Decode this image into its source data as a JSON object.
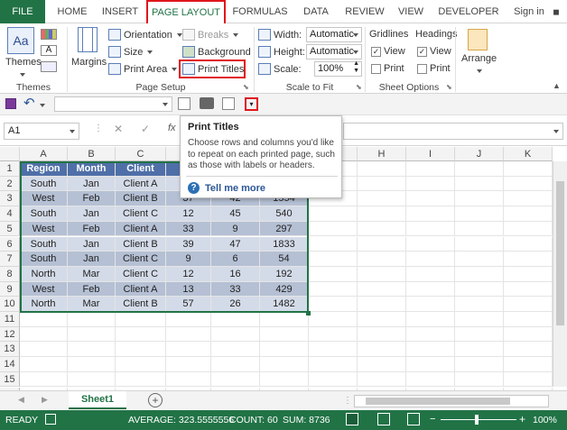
{
  "tabs": [
    "FILE",
    "HOME",
    "INSERT",
    "PAGE LAYOUT",
    "FORMULAS",
    "DATA",
    "REVIEW",
    "VIEW",
    "DEVELOPER"
  ],
  "sign_in": "Sign in",
  "ribbon": {
    "themes": {
      "themes_label": "Themes",
      "group": "Themes"
    },
    "page_setup": {
      "margins": "Margins",
      "orientation": "Orientation",
      "size": "Size",
      "print_area": "Print Area",
      "breaks": "Breaks",
      "background": "Background",
      "print_titles": "Print Titles",
      "group": "Page Setup"
    },
    "scale": {
      "width_label": "Width:",
      "width_value": "Automatic",
      "height_label": "Height:",
      "height_value": "Automatic",
      "scale_label": "Scale:",
      "scale_value": "100%",
      "group": "Scale to Fit"
    },
    "sheet_options": {
      "gridlines": "Gridlines",
      "headings": "Headings",
      "view": "View",
      "print": "Print",
      "group": "Sheet Options"
    },
    "arrange": "Arrange"
  },
  "name_box": "A1",
  "fx": "fx",
  "tooltip": {
    "title": "Print Titles",
    "body": "Choose rows and columns you'd like to repeat on each printed page, such as those with labels or headers.",
    "link": "Tell me more"
  },
  "columns": [
    "A",
    "B",
    "C",
    "D",
    "E",
    "F",
    "G",
    "H",
    "I",
    "J",
    "K"
  ],
  "header_row": [
    "Region",
    "Month",
    "Client",
    "Qu",
    "",
    "",
    ""
  ],
  "rows": [
    [
      "South",
      "Jan",
      "Client A",
      "",
      "",
      "",
      ""
    ],
    [
      "West",
      "Feb",
      "Client B",
      "37",
      "42",
      "1554"
    ],
    [
      "South",
      "Jan",
      "Client C",
      "12",
      "45",
      "540"
    ],
    [
      "West",
      "Feb",
      "Client A",
      "33",
      "9",
      "297"
    ],
    [
      "South",
      "Jan",
      "Client B",
      "39",
      "47",
      "1833"
    ],
    [
      "South",
      "Jan",
      "Client C",
      "9",
      "6",
      "54"
    ],
    [
      "North",
      "Mar",
      "Client C",
      "12",
      "16",
      "192"
    ],
    [
      "West",
      "Feb",
      "Client A",
      "13",
      "33",
      "429"
    ],
    [
      "North",
      "Mar",
      "Client B",
      "57",
      "26",
      "1482"
    ]
  ],
  "row_numbers": [
    "1",
    "2",
    "3",
    "4",
    "5",
    "6",
    "7",
    "8",
    "9",
    "10",
    "11",
    "12",
    "13",
    "14",
    "15",
    "16"
  ],
  "sheet_tab": "Sheet1",
  "status": {
    "ready": "READY",
    "average": "AVERAGE: 323.5555556",
    "count": "COUNT: 60",
    "sum": "SUM: 8736",
    "zoom": "100%"
  },
  "colors": {
    "excel_green": "#217346",
    "accent_red": "#e0161b",
    "header_blue": "#4f6fa8"
  }
}
